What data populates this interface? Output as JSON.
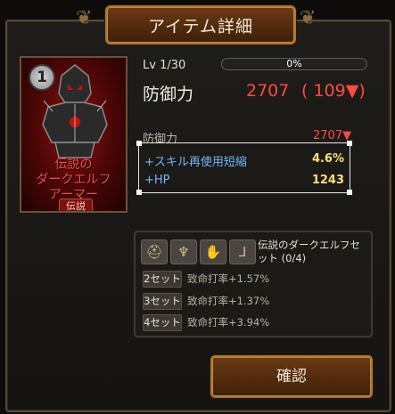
{
  "title": "アイテム詳細",
  "item": {
    "rank": "1",
    "name": "伝説の\nダークエルフ\nアーマー",
    "rarity": "伝説",
    "level": "Lv 1/30",
    "exp_percent": "0%",
    "exp_fraction": 0.0,
    "main_stat": {
      "label": "防御力",
      "value": "2707",
      "diff": "( 109▼)"
    },
    "sub_stat": {
      "label": "防御力",
      "value": "2707▼"
    },
    "options": [
      {
        "label": "+スキル再使用短縮",
        "value": "4.6%"
      },
      {
        "label": "+HP",
        "value": "1243"
      }
    ]
  },
  "set": {
    "name": "伝説のダークエルフセット (0/4)",
    "icons": [
      "helmet-icon",
      "shoulder-icon",
      "gloves-icon",
      "boots-icon"
    ],
    "bonuses": [
      {
        "tag": "2セット",
        "text": "致命打率+1.57%"
      },
      {
        "tag": "3セット",
        "text": "致命打率+1.37%"
      },
      {
        "tag": "4セット",
        "text": "致命打率+3.94%"
      }
    ]
  },
  "buttons": {
    "confirm": "確認"
  }
}
